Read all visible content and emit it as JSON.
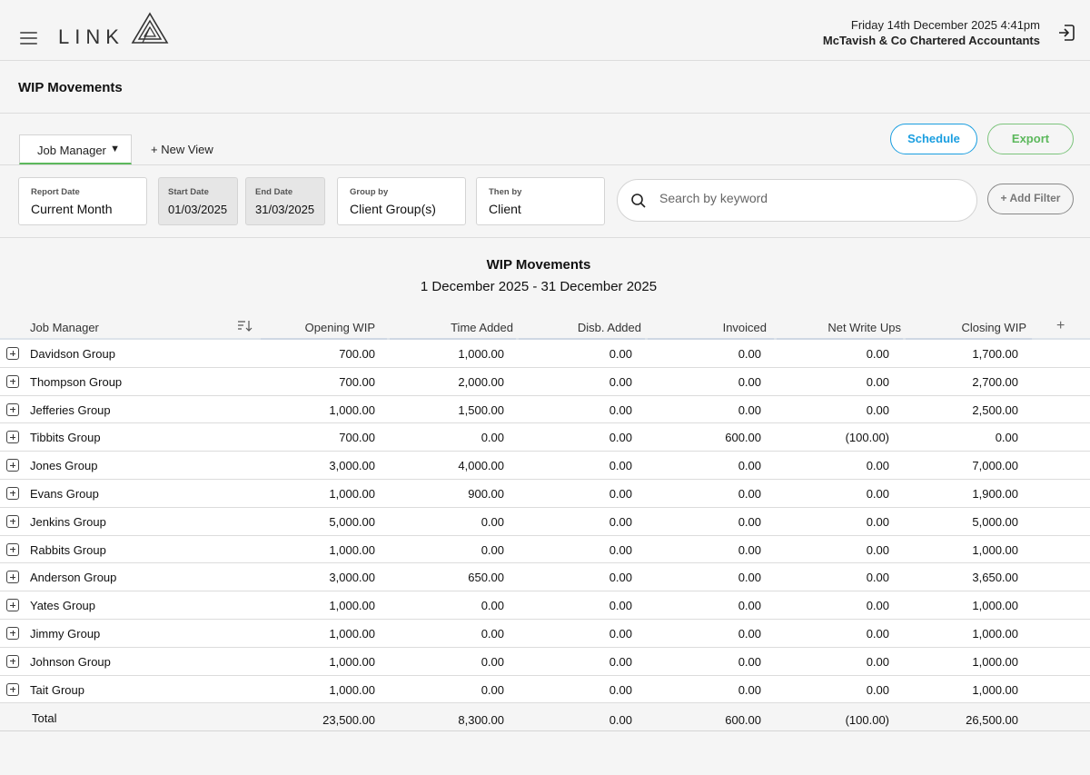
{
  "header": {
    "logo_text": "LINK",
    "datetime": "Friday 14th December 2025  4:41pm",
    "firm_name": "McTavish & Co Chartered Accountants"
  },
  "page": {
    "title": "WIP Movements"
  },
  "views": {
    "active_view": "Job Manager",
    "new_view_label": "+ New View",
    "schedule_label": "Schedule",
    "export_label": "Export"
  },
  "filters": {
    "report_date": {
      "label": "Report Date",
      "value": "Current Month"
    },
    "start_date": {
      "label": "Start Date",
      "value": "01/03/2025"
    },
    "end_date": {
      "label": "End Date",
      "value": "31/03/2025"
    },
    "group_by": {
      "label": "Group by",
      "value": "Client Group(s)"
    },
    "then_by": {
      "label": "Then by",
      "value": "Client"
    },
    "search_placeholder": "Search by keyword",
    "add_filter_label": "+ Add Filter"
  },
  "report": {
    "title": "WIP Movements",
    "range": "1 December 2025 - 31 December 2025"
  },
  "table": {
    "columns": [
      "Job Manager",
      "Opening WIP",
      "Time Added",
      "Disb. Added",
      "Invoiced",
      "Net Write Ups",
      "Closing WIP"
    ],
    "add_column_label": "+",
    "rows": [
      [
        "Davidson Group",
        "700.00",
        "1,000.00",
        "0.00",
        "0.00",
        "0.00",
        "1,700.00"
      ],
      [
        "Thompson Group",
        "700.00",
        "2,000.00",
        "0.00",
        "0.00",
        "0.00",
        "2,700.00"
      ],
      [
        "Jefferies Group",
        "1,000.00",
        "1,500.00",
        "0.00",
        "0.00",
        "0.00",
        "2,500.00"
      ],
      [
        "Tibbits Group",
        "700.00",
        "0.00",
        "0.00",
        "600.00",
        "(100.00)",
        "0.00"
      ],
      [
        "Jones Group",
        "3,000.00",
        "4,000.00",
        "0.00",
        "0.00",
        "0.00",
        "7,000.00"
      ],
      [
        "Evans Group",
        "1,000.00",
        "900.00",
        "0.00",
        "0.00",
        "0.00",
        "1,900.00"
      ],
      [
        "Jenkins Group",
        "5,000.00",
        "0.00",
        "0.00",
        "0.00",
        "0.00",
        "5,000.00"
      ],
      [
        "Rabbits Group",
        "1,000.00",
        "0.00",
        "0.00",
        "0.00",
        "0.00",
        "1,000.00"
      ],
      [
        "Anderson Group",
        "3,000.00",
        "650.00",
        "0.00",
        "0.00",
        "0.00",
        "3,650.00"
      ],
      [
        "Yates Group",
        "1,000.00",
        "0.00",
        "0.00",
        "0.00",
        "0.00",
        "1,000.00"
      ],
      [
        "Jimmy Group",
        "1,000.00",
        "0.00",
        "0.00",
        "0.00",
        "0.00",
        "1,000.00"
      ],
      [
        "Johnson Group",
        "1,000.00",
        "0.00",
        "0.00",
        "0.00",
        "0.00",
        "1,000.00"
      ],
      [
        "Tait Group",
        "1,000.00",
        "0.00",
        "0.00",
        "0.00",
        "0.00",
        "1,000.00"
      ]
    ],
    "total": [
      "Total",
      "23,500.00",
      "8,300.00",
      "0.00",
      "600.00",
      "(100.00)",
      "26,500.00"
    ]
  },
  "colors": {
    "schedule_accent": "#1a9ee0",
    "export_accent": "#5cb85c",
    "active_tab_underline": "#5cb85c"
  }
}
